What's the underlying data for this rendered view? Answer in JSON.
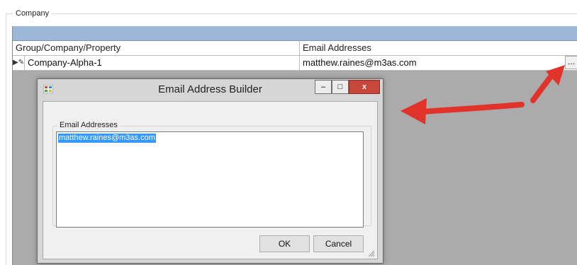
{
  "groupbox": {
    "title": "Company"
  },
  "grid": {
    "columns": [
      "Group/Company/Property",
      "Email Addresses"
    ],
    "rows": [
      {
        "indicator": "▶✎",
        "group": "Company-Alpha-1",
        "email": "matthew.raines@m3as.com",
        "button": "..."
      }
    ]
  },
  "dialog": {
    "title": "Email Address Builder",
    "minimize_glyph": "–",
    "maximize_glyph": "□",
    "close_glyph": "x",
    "group_title": "Email Addresses",
    "textarea_value": "matthew.raines@m3as.com",
    "ok_label": "OK",
    "cancel_label": "Cancel"
  },
  "colors": {
    "grid_topbar": "#9db7d8",
    "close_button": "#c8473b",
    "selection": "#3399ff",
    "annotation_arrow": "#e2332a"
  },
  "icons": {
    "row_indicator": "current-row-edit-icon",
    "dialog_app": "form-app-icon",
    "arrows": "annotation-arrow-icon"
  }
}
